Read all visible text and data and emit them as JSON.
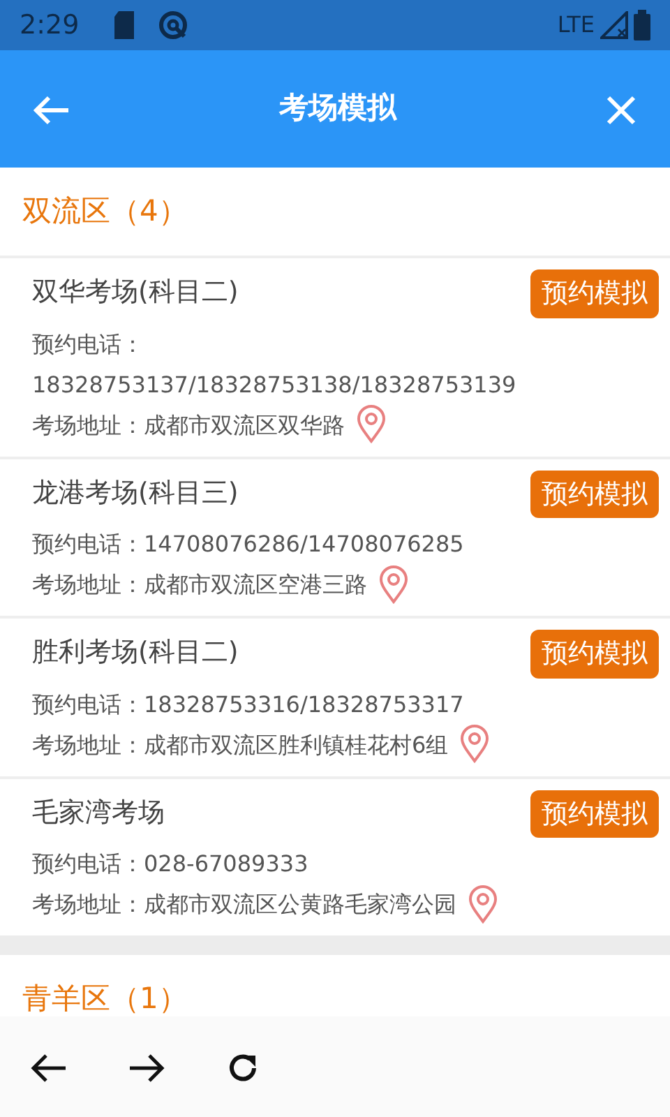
{
  "status_bar": {
    "time": "2:29",
    "network": "LTE"
  },
  "app_bar": {
    "title": "考场模拟"
  },
  "districts": [
    {
      "name": "双流区（4）",
      "venues": [
        {
          "name": "双华考场(科目二)",
          "button": "预约模拟",
          "phone": "预约电话：18328753137/18328753138/18328753139",
          "address": "考场地址：成都市双流区双华路"
        },
        {
          "name": "龙港考场(科目三)",
          "button": "预约模拟",
          "phone": "预约电话：14708076286/14708076285",
          "address": "考场地址：成都市双流区空港三路"
        },
        {
          "name": "胜利考场(科目二)",
          "button": "预约模拟",
          "phone": "预约电话：18328753316/18328753317",
          "address": "考场地址：成都市双流区胜利镇桂花村6组"
        },
        {
          "name": "毛家湾考场",
          "button": "预约模拟",
          "phone": "预约电话：028-67089333",
          "address": "考场地址：成都市双流区公黄路毛家湾公园"
        }
      ]
    },
    {
      "name": "青羊区（1）"
    }
  ]
}
